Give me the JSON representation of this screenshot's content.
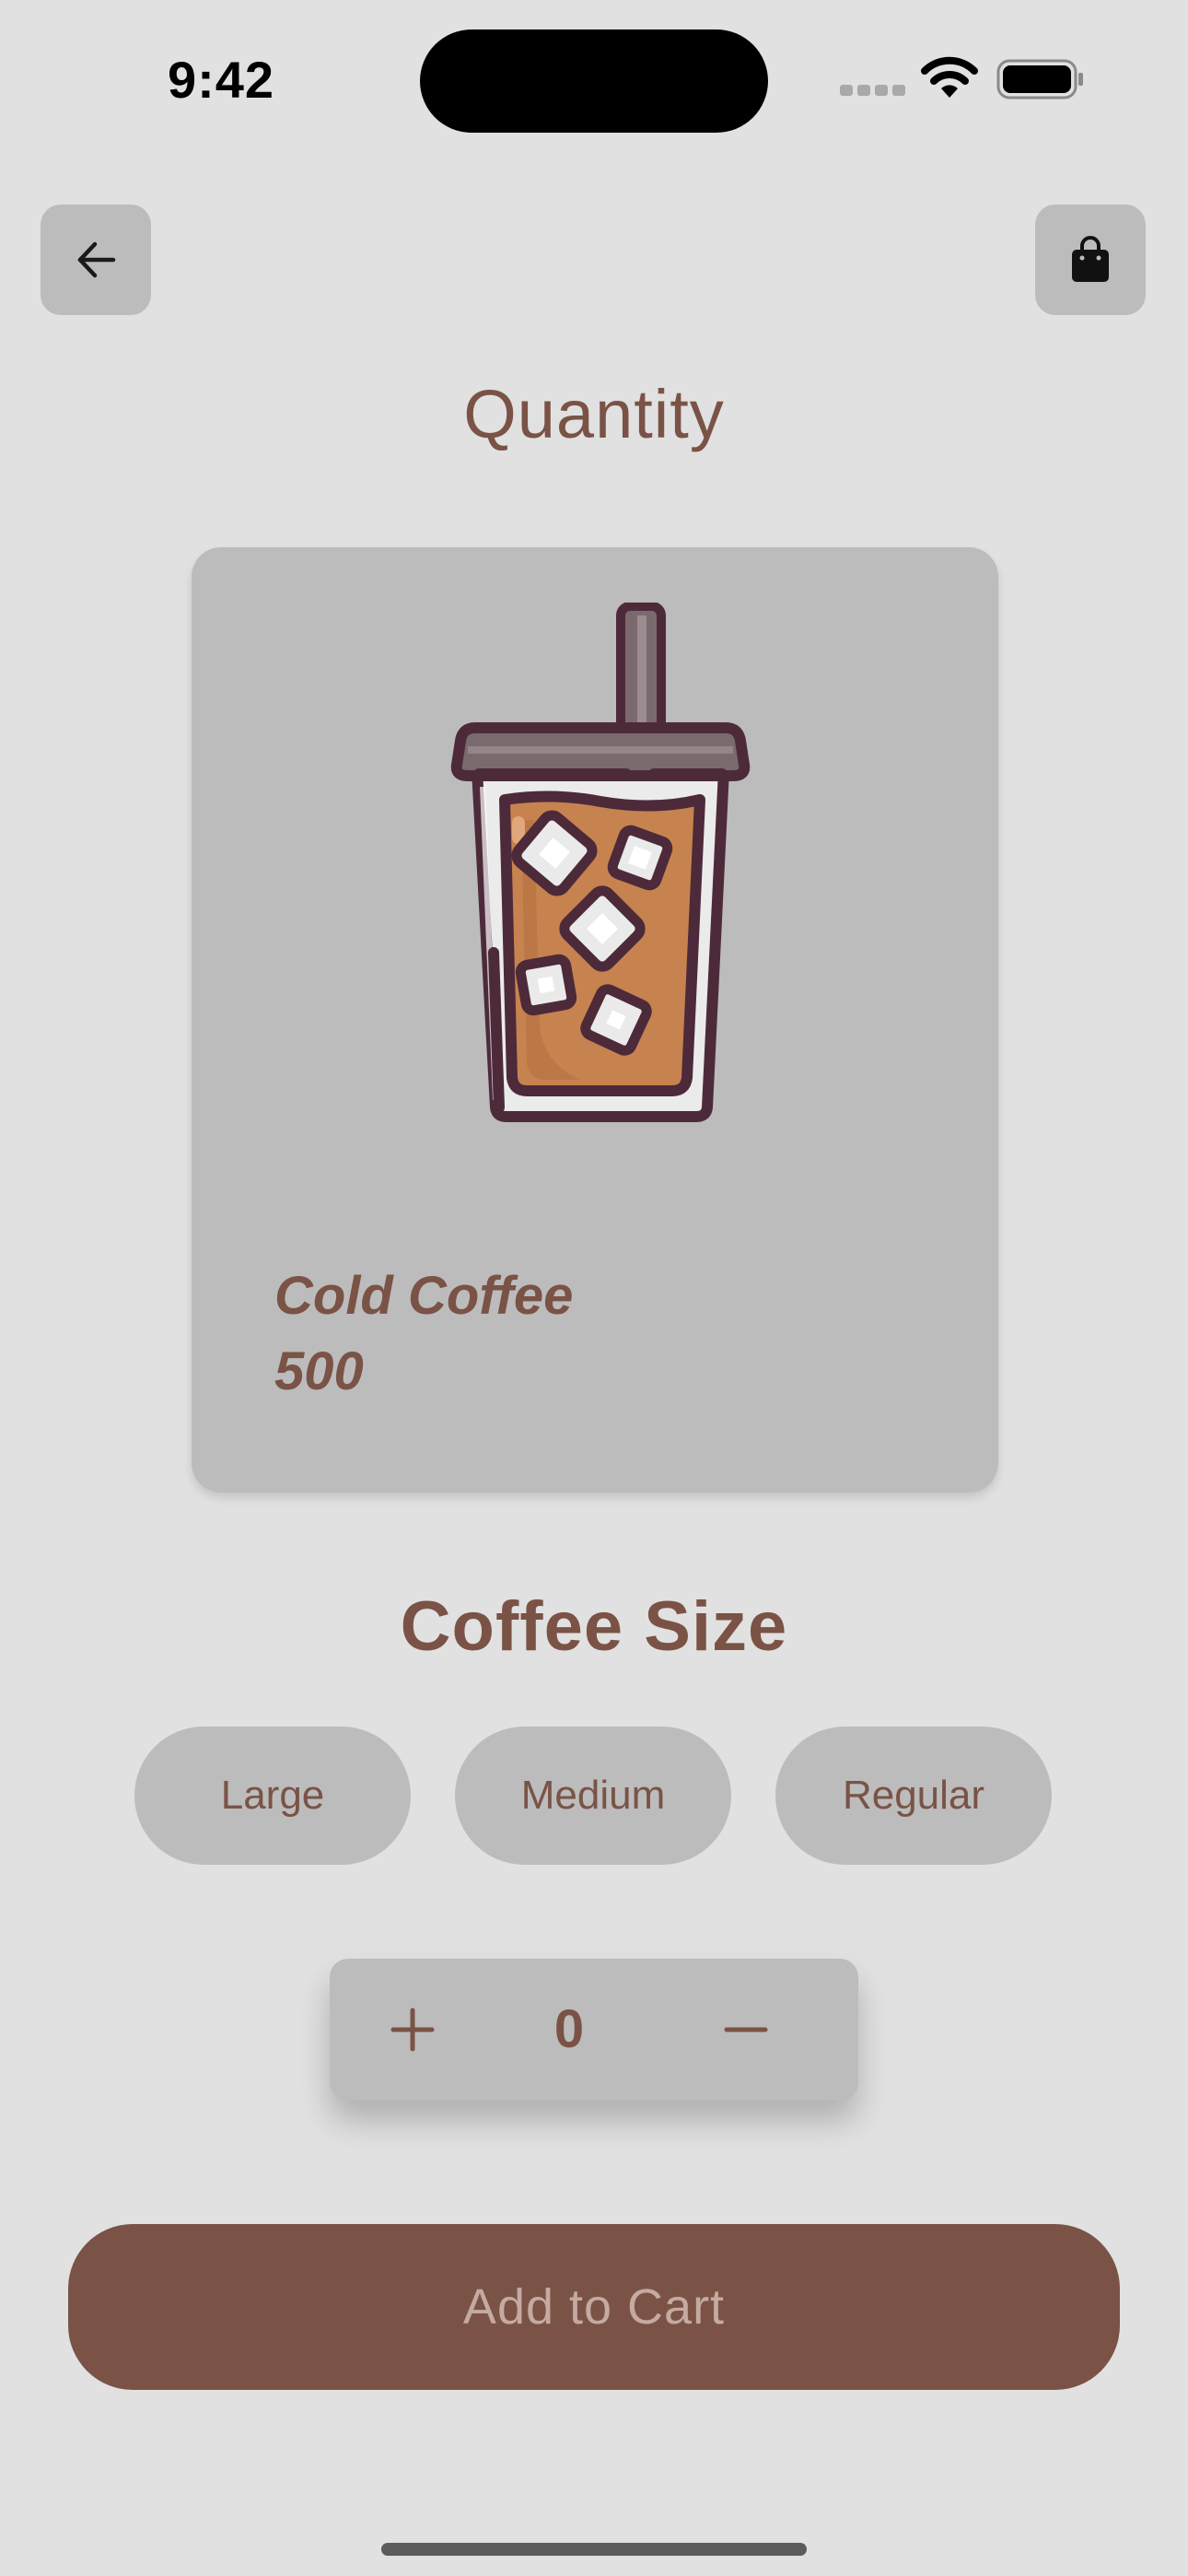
{
  "status_bar": {
    "time": "9:42"
  },
  "header": {
    "title": "Quantity"
  },
  "product": {
    "name": "Cold Coffee",
    "price": "500"
  },
  "size_section": {
    "heading": "Coffee Size",
    "options": [
      "Large",
      "Medium",
      "Regular"
    ]
  },
  "quantity": {
    "value": "0"
  },
  "cart_button": {
    "label": "Add to Cart"
  },
  "colors": {
    "background": "#e1e1e1",
    "surface": "#bcbcbc",
    "brand_brown": "#7a5346",
    "button_text": "#c4aaa1"
  },
  "icons": {
    "back": "arrow-left-icon",
    "bag": "shopping-bag-icon",
    "plus": "plus-icon",
    "minus": "minus-icon"
  }
}
